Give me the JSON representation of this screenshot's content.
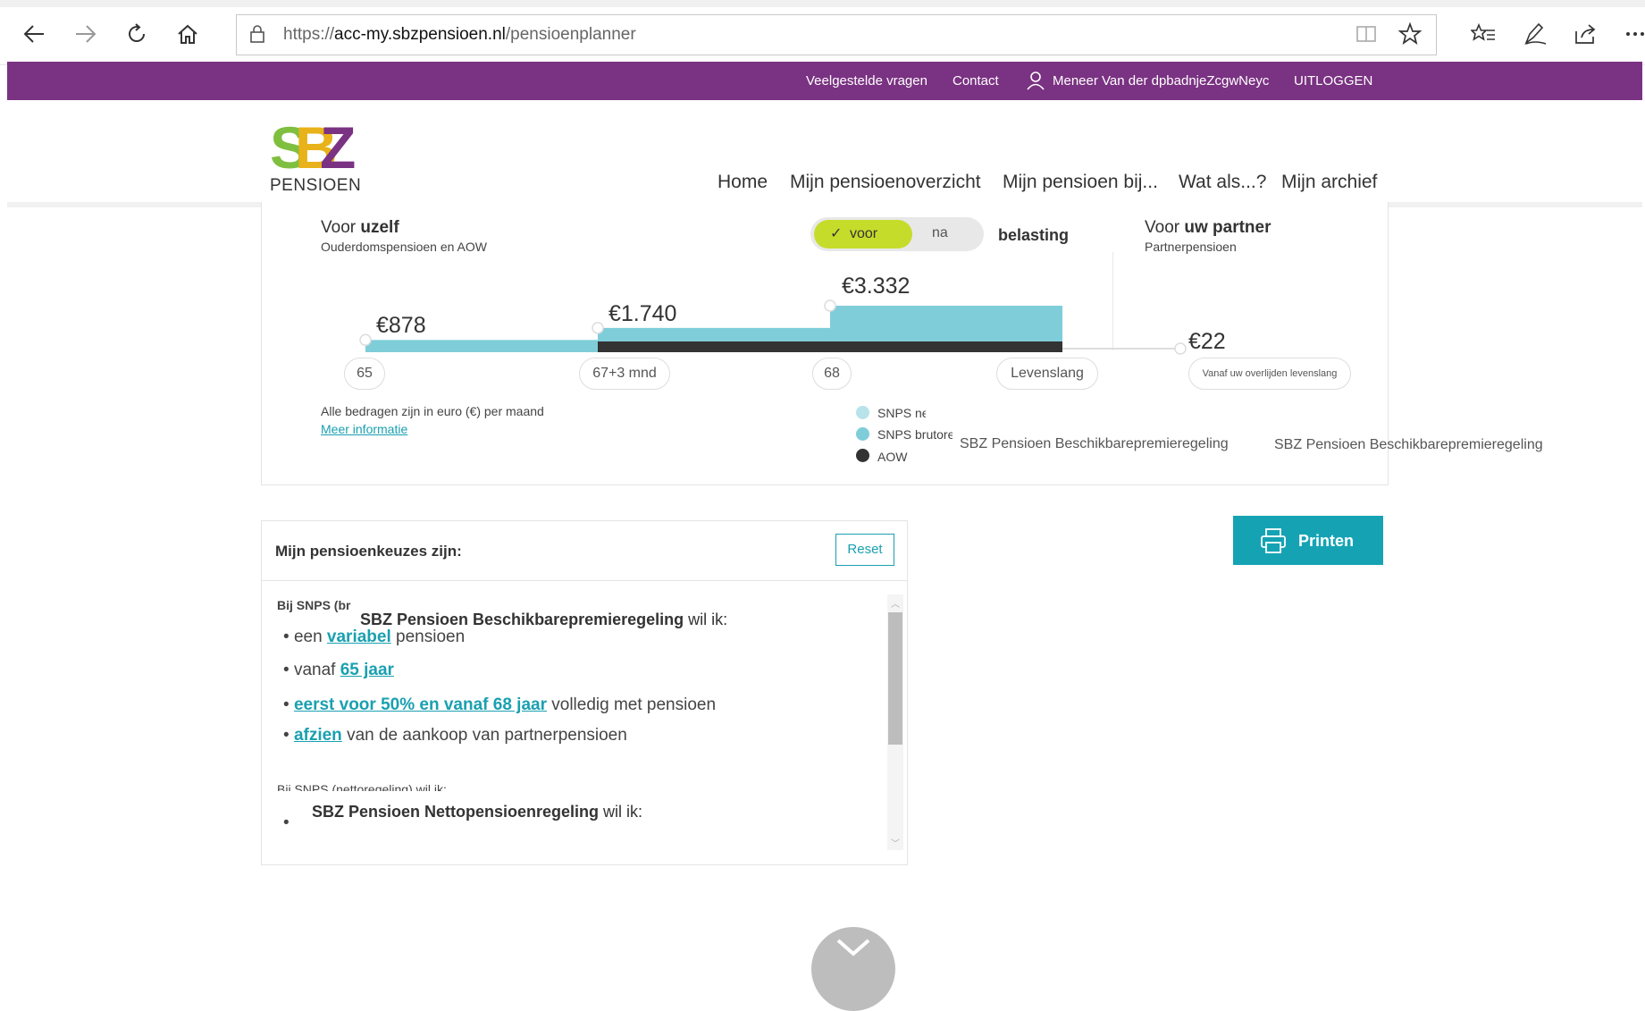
{
  "browser": {
    "url_prefix": "https://",
    "url_host": "acc-my.sbzpensioen.nl",
    "url_path": "/pensioenplanner"
  },
  "topbar": {
    "faq": "Veelgestelde vragen",
    "contact": "Contact",
    "user": "Meneer Van der dpbadnjeZcgwNeyc",
    "logout": "UITLOGGEN"
  },
  "logo": {
    "text": "PENSIOEN",
    "mark": "SBZ"
  },
  "nav": [
    "Home",
    "Mijn pensioenoverzicht",
    "Mijn pensioen bij...",
    "Wat als...?",
    "Mijn archief"
  ],
  "self": {
    "title_prefix": "Voor ",
    "title_bold": "uzelf",
    "subtitle": "Ouderdomspensioen en AOW"
  },
  "toggle": {
    "voor": "voor",
    "na": "na",
    "label": "belasting"
  },
  "partner": {
    "title_prefix": "Voor ",
    "title_bold": "uw partner",
    "subtitle": "Partnerpensioen",
    "amount": "€22",
    "pill": "Vanaf uw overlijden levenslang"
  },
  "chart_data": {
    "type": "bar",
    "categories": [
      "65",
      "67+3 mnd",
      "68",
      "Levenslang"
    ],
    "amounts_labels": [
      "€878",
      "€1.740",
      "€3.332"
    ],
    "series": [
      {
        "name": "SNPS netto",
        "values": [
          878,
          1740,
          3332
        ]
      },
      {
        "name": "AOW",
        "values": [
          0,
          1,
          1
        ]
      }
    ]
  },
  "notes": {
    "amounts": "Alle bedragen zijn in euro (€) per maand",
    "more": "Meer informatie"
  },
  "legend": {
    "items": [
      {
        "label": "SNPS ne",
        "color": "#b8e3ea"
      },
      {
        "label": "SNPS brutore",
        "color": "#7fcdd9"
      },
      {
        "label": "AOW",
        "color": "#333333"
      }
    ],
    "overlay1": "SBZ Pensioen Beschikbarepremieregeling",
    "overlay2": "SBZ Pensioen Beschikbarepremieregeling"
  },
  "choices": {
    "title": "Mijn pensioenkeuzes zijn:",
    "reset": "Reset",
    "section1_label": "Bij SNPS (br",
    "overlay1_bold": "SBZ Pensioen Beschikbarepremieregeling",
    "overlay1_rest": " wil ik:",
    "b1_pre": "een ",
    "b1_link": "variabel",
    "b1_post": " pensioen",
    "b2_pre": "vanaf ",
    "b2_link": "65 jaar",
    "b3_link": "eerst voor 50% en vanaf 68 jaar",
    "b3_post": " volledig met pensioen",
    "b4_link": "afzien",
    "b4_post": " van de aankoop van partnerpensioen",
    "section2_label": "Bij SNPS (nettoregeling) wil ik:",
    "overlay2_bold": "SBZ Pensioen Nettopensioenregeling",
    "overlay2_rest": " wil ik:"
  },
  "print": {
    "label": "Printen"
  }
}
